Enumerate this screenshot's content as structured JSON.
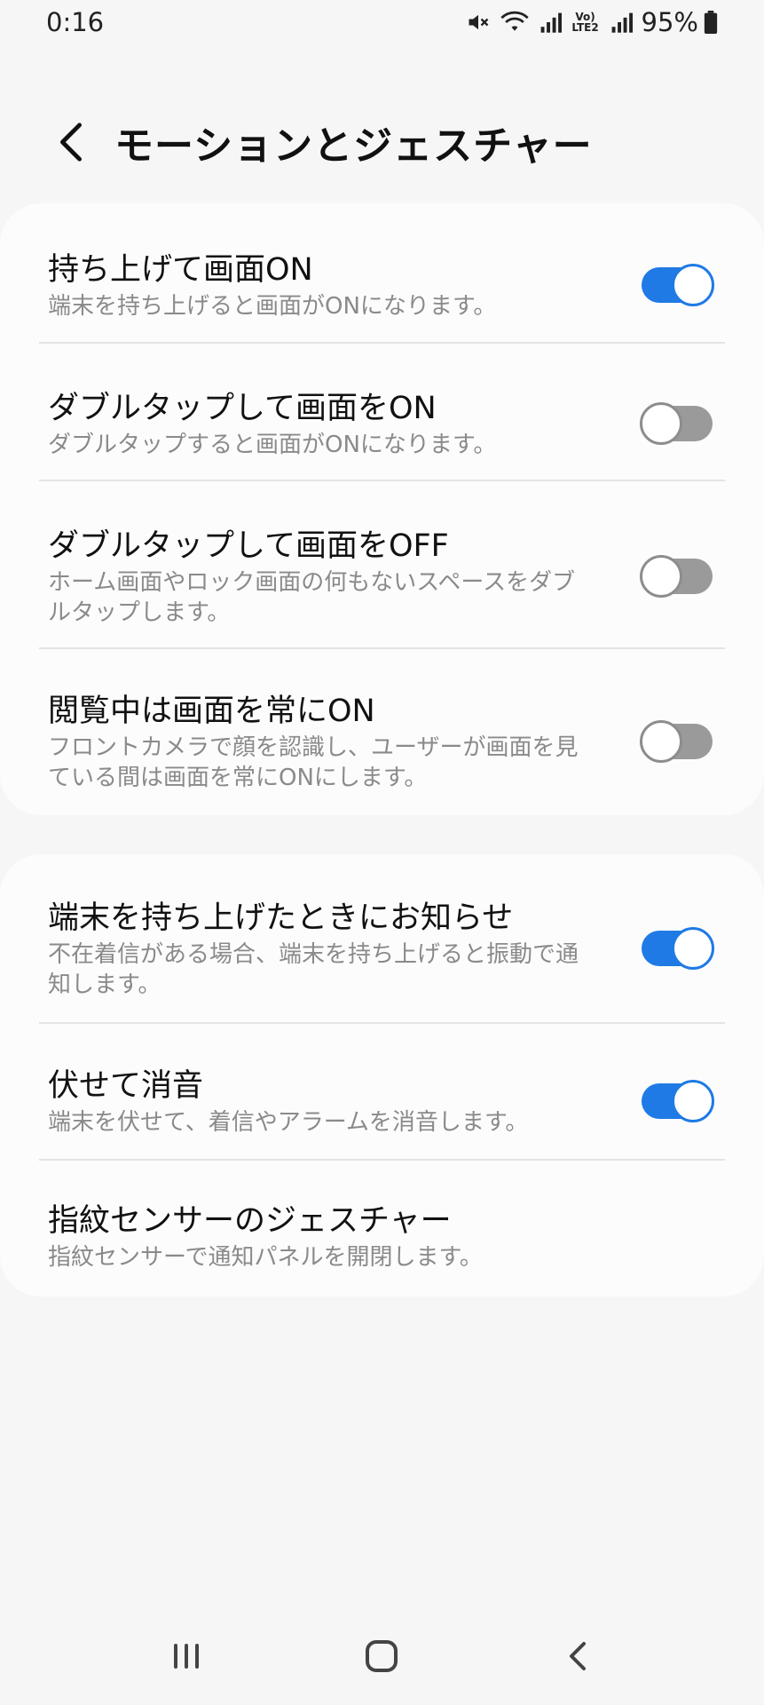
{
  "status_bar": {
    "time": "0:16",
    "battery_percent": "95%",
    "network_label": "Vo) LTE2",
    "icons": [
      "mute-icon",
      "wifi-icon",
      "signal-icon",
      "volte-icon",
      "signal-icon",
      "battery-icon"
    ]
  },
  "header": {
    "title": "モーションとジェスチャー"
  },
  "settings": [
    {
      "title": "持ち上げて画面ON",
      "description": "端末を持ち上げると画面がONになります。",
      "enabled": true
    },
    {
      "title": "ダブルタップして画面をON",
      "description": "ダブルタップすると画面がONになります。",
      "enabled": false
    },
    {
      "title": "ダブルタップして画面をOFF",
      "description": "ホーム画面やロック画面の何もないスペースをダブルタップします。",
      "enabled": false
    },
    {
      "title": "閲覧中は画面を常にON",
      "description": "フロントカメラで顔を認識し、ユーザーが画面を見ている間は画面を常にONにします。",
      "enabled": false
    },
    {
      "title": "端末を持ち上げたときにお知らせ",
      "description": "不在着信がある場合、端末を持ち上げると振動で通知します。",
      "enabled": true
    },
    {
      "title": "伏せて消音",
      "description": "端末を伏せて、着信やアラームを消音します。",
      "enabled": true
    },
    {
      "title": "指紋センサーのジェスチャー",
      "description": "指紋センサーで通知パネルを開閉します。"
    }
  ],
  "colors": {
    "accent": "#1f7ae5",
    "toggle_off": "#9a9a9a",
    "background": "#f6f6f6",
    "card": "#fcfcfc"
  },
  "nav_bar": {
    "icons": [
      "recent-apps-icon",
      "home-icon",
      "back-icon"
    ]
  }
}
